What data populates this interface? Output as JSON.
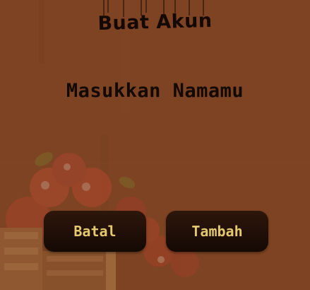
{
  "dialog": {
    "title": "Buat Akun",
    "prompt": "Masukkan Namamu",
    "cancel_label": "Batal",
    "add_label": "Tambah"
  },
  "colors": {
    "background": "#7d4322",
    "button": "#1d0d06",
    "button_text": "#e4ca6d",
    "text": "#150905"
  }
}
